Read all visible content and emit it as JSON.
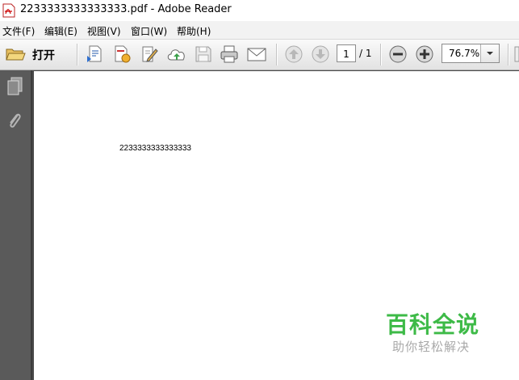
{
  "window": {
    "title": "2233333333333333.pdf - Adobe Reader"
  },
  "menu": {
    "items": [
      "文件(F)",
      "编辑(E)",
      "视图(V)",
      "窗口(W)",
      "帮助(H)"
    ]
  },
  "toolbar": {
    "open_label": "打开",
    "page_current": "1",
    "page_total": "/ 1",
    "zoom": "76.7%"
  },
  "document": {
    "text": "2233333333333333"
  },
  "watermark": {
    "main": "百科全说",
    "sub": "助你轻松解决"
  },
  "colors": {
    "watermark_green": "#3dba47",
    "sidebar_bg": "#5a5a5a"
  }
}
